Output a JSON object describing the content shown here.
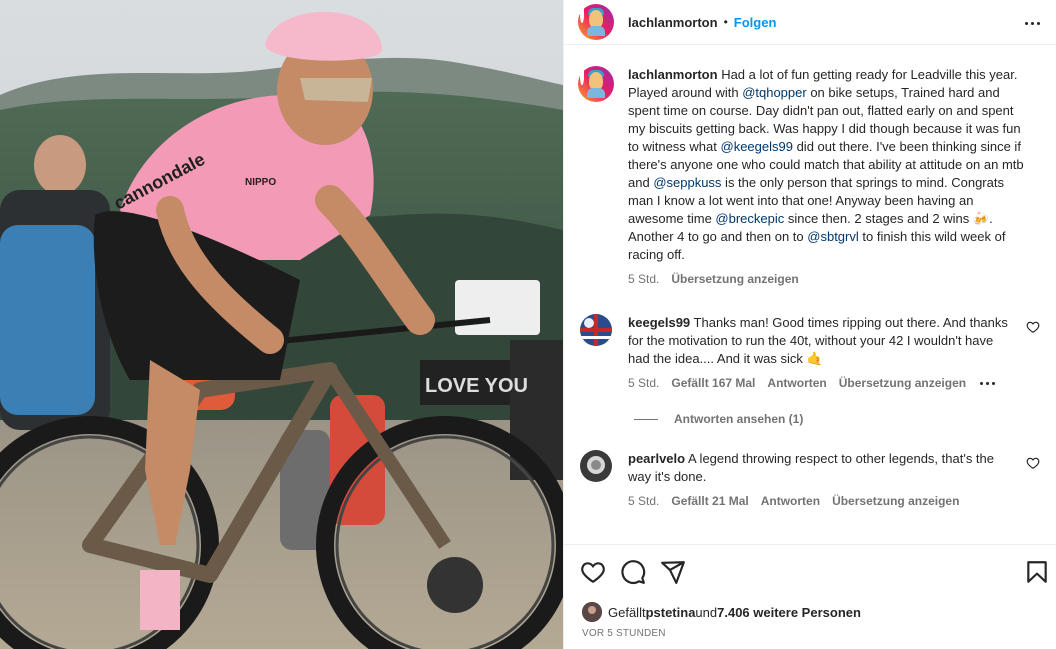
{
  "post": {
    "author": "lachlanmorton",
    "follow_label": "Folgen",
    "separator": "•"
  },
  "caption": {
    "username": "lachlanmorton",
    "text_1": " Had a lot of fun getting ready for Leadville this year. Played around with ",
    "mention_1": "@tqhopper",
    "text_2": " on bike setups, Trained hard and spent time on course. Day didn't pan out, flatted early on and spent my biscuits getting back. Was happy I did though because it was fun to witness what ",
    "mention_2": "@keegels99",
    "text_3": " did out there. I've been thinking since if there's anyone one who could match that ability at attitude on an mtb and ",
    "mention_3": "@seppkuss",
    "text_4": " is the only person that springs to mind. Congrats man I know a lot went into that one! Anyway been having an awesome time ",
    "mention_4": "@breckepic",
    "text_5": " since then. 2 stages and 2 wins 🍻. Another 4 to go and then on to ",
    "mention_5": "@sbtgrvl",
    "text_6": " to finish this wild week of racing off.",
    "time": "5 Std.",
    "translate": "Übersetzung anzeigen"
  },
  "comments": [
    {
      "username": "keegels99",
      "text": " Thanks man! Good times ripping out there. And thanks for the motivation to run the 40t, without your 42 I wouldn't have had the idea.... And it was sick 🤙",
      "time": "5 Std.",
      "likes": "Gefällt 167 Mal",
      "reply": "Antworten",
      "translate": "Übersetzung anzeigen",
      "view_replies": "Antworten ansehen (1)"
    },
    {
      "username": "pearlvelo",
      "text": " A legend throwing respect to other legends, that's the way it's done.",
      "time": "5 Std.",
      "likes": "Gefällt 21 Mal",
      "reply": "Antworten",
      "translate": "Übersetzung anzeigen"
    }
  ],
  "likes_line": {
    "prefix": "Gefällt ",
    "user": "pstetina",
    "middle": " und ",
    "others": "7.406 weitere Personen"
  },
  "timestamp": "VOR 5 STUNDEN",
  "icons": [
    "more-options-icon",
    "heart-icon",
    "comment-icon",
    "share-icon",
    "bookmark-icon"
  ],
  "colors": {
    "link": "#0095f6",
    "mention": "#00376b",
    "muted": "#737373"
  }
}
